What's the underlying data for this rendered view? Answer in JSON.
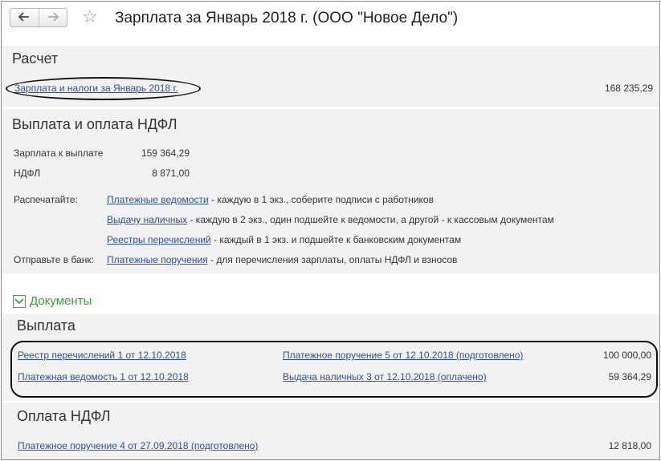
{
  "window": {
    "title": "Зарплата за Январь 2018 г. (ООО \"Новое Дело\")",
    "back_icon": "arrow-left",
    "forward_icon": "arrow-right",
    "favorite_icon": "star"
  },
  "calc": {
    "header": "Расчет",
    "link": "Зарплата и налоги за Январь 2018 г.",
    "amount": "168 235,29"
  },
  "payout": {
    "header": "Выплата и оплата НДФЛ",
    "salary_label": "Зарплата к выплате",
    "salary_value": "159 364,29",
    "ndfl_label": "НДФЛ",
    "ndfl_value": "8 871,00",
    "print_label": "Распечатайте:",
    "print_items": [
      {
        "link": "Платежные ведомости",
        "desc": " - каждую в 1 экз., соберите подписи с работников"
      },
      {
        "link": "Выдачу наличных",
        "desc": " - каждую в 2 экз., один подшейте к ведомости, а другой - к кассовым документам"
      },
      {
        "link": "Реестры перечислений",
        "desc": " - каждый в 1 экз. и подшейте к банковским документам"
      }
    ],
    "bank_label": "Отправьте в банк:",
    "bank_item": {
      "link": "Платежные поручения",
      "desc": " - для перечисления зарплаты, оплаты НДФЛ и взносов"
    }
  },
  "documents": {
    "toggle_label": "Документы",
    "payment_header": "Выплата",
    "payment_rows": [
      {
        "left": "Реестр перечислений 1 от 12.10.2018",
        "right": "Платежное поручение 5 от 12.10.2018 (подготовлено)",
        "amount": "100 000,00"
      },
      {
        "left": "Платежная ведомость 1 от 12.10.2018",
        "right": "Выдача наличных 3 от 12.10.2018 (оплачено)",
        "amount": "59 364,29"
      }
    ],
    "ndfl_header": "Оплата НДФЛ",
    "ndfl_row": {
      "left": "Платежное поручение 4 от 27.09.2018 (подготовлено)",
      "amount": "12 818,00"
    }
  }
}
